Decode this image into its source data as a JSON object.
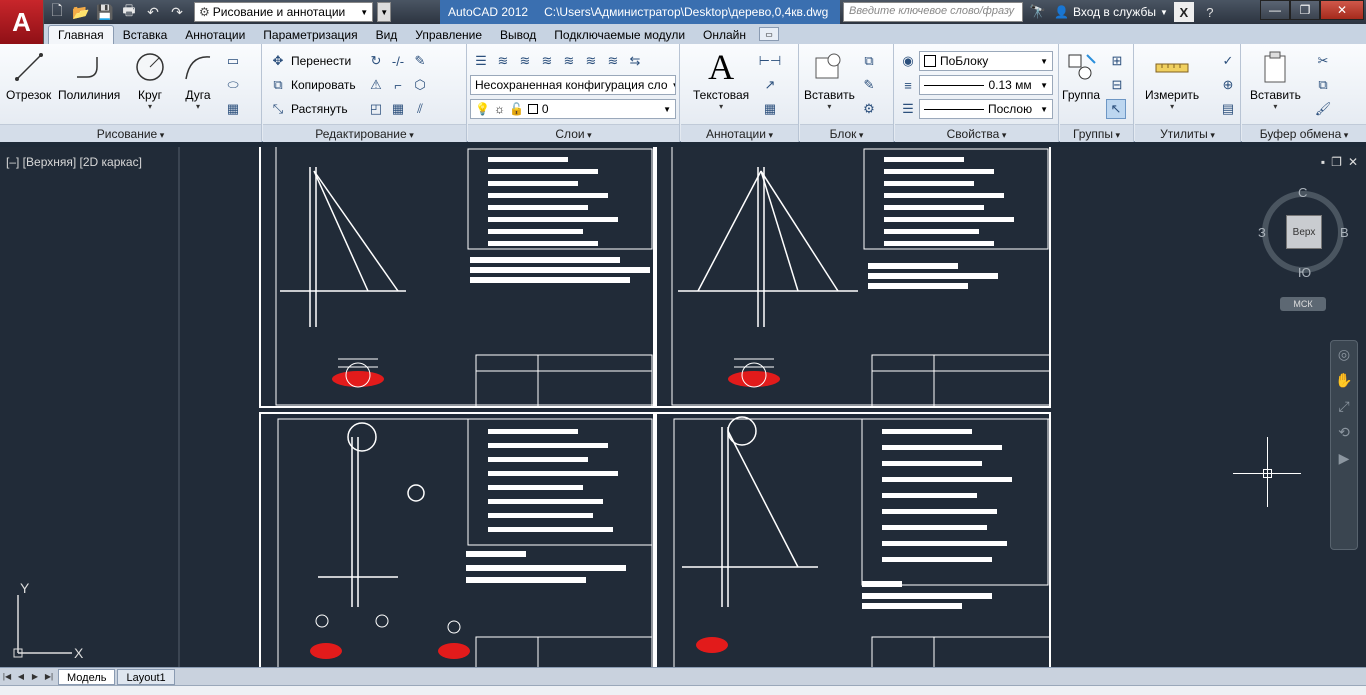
{
  "titlebar": {
    "app_logo": "A",
    "workspace": "Рисование и аннотации",
    "app_name": "AutoCAD 2012",
    "file_path": "C:\\Users\\Администратор\\Desktop\\дерево,0,4кв.dwg",
    "search_placeholder": "Введите ключевое слово/фразу",
    "login": "Вход в службы"
  },
  "tabs": [
    "Главная",
    "Вставка",
    "Аннотации",
    "Параметризация",
    "Вид",
    "Управление",
    "Вывод",
    "Подключаемые модули",
    "Онлайн"
  ],
  "ribbon": {
    "draw": {
      "title": "Рисование",
      "line": "Отрезок",
      "polyline": "Полилиния",
      "circle": "Круг",
      "arc": "Дуга"
    },
    "modify": {
      "title": "Редактирование",
      "move": "Перенести",
      "copy": "Копировать",
      "stretch": "Растянуть"
    },
    "layers": {
      "title": "Слои",
      "layer_state": "Несохраненная конфигурация сло",
      "current_layer": "0"
    },
    "annotation": {
      "title": "Аннотации",
      "text": "Текстовая"
    },
    "block": {
      "title": "Блок",
      "insert": "Вставить"
    },
    "properties": {
      "title": "Свойства",
      "color": "ПоБлоку",
      "lineweight": "0.13 мм",
      "linetype": "Послою"
    },
    "groups": {
      "title": "Группы",
      "group": "Группа"
    },
    "utilities": {
      "title": "Утилиты",
      "measure": "Измерить"
    },
    "clipboard": {
      "title": "Буфер обмена",
      "paste": "Вставить"
    }
  },
  "canvas": {
    "viewport_label": "[–] [Верхняя] [2D каркас]",
    "viewcube": {
      "face": "Верх",
      "north": "С",
      "south": "Ю",
      "east": "В",
      "west": "З"
    },
    "ucs_menu": "МСК",
    "ucs_y": "Y",
    "ucs_x": "X"
  },
  "layout_tabs": [
    "Модель",
    "Layout1"
  ],
  "colors": {
    "canvas": "#212b38",
    "ribbon": "#e2e8f0",
    "red_highlight": "#e21b1b"
  }
}
